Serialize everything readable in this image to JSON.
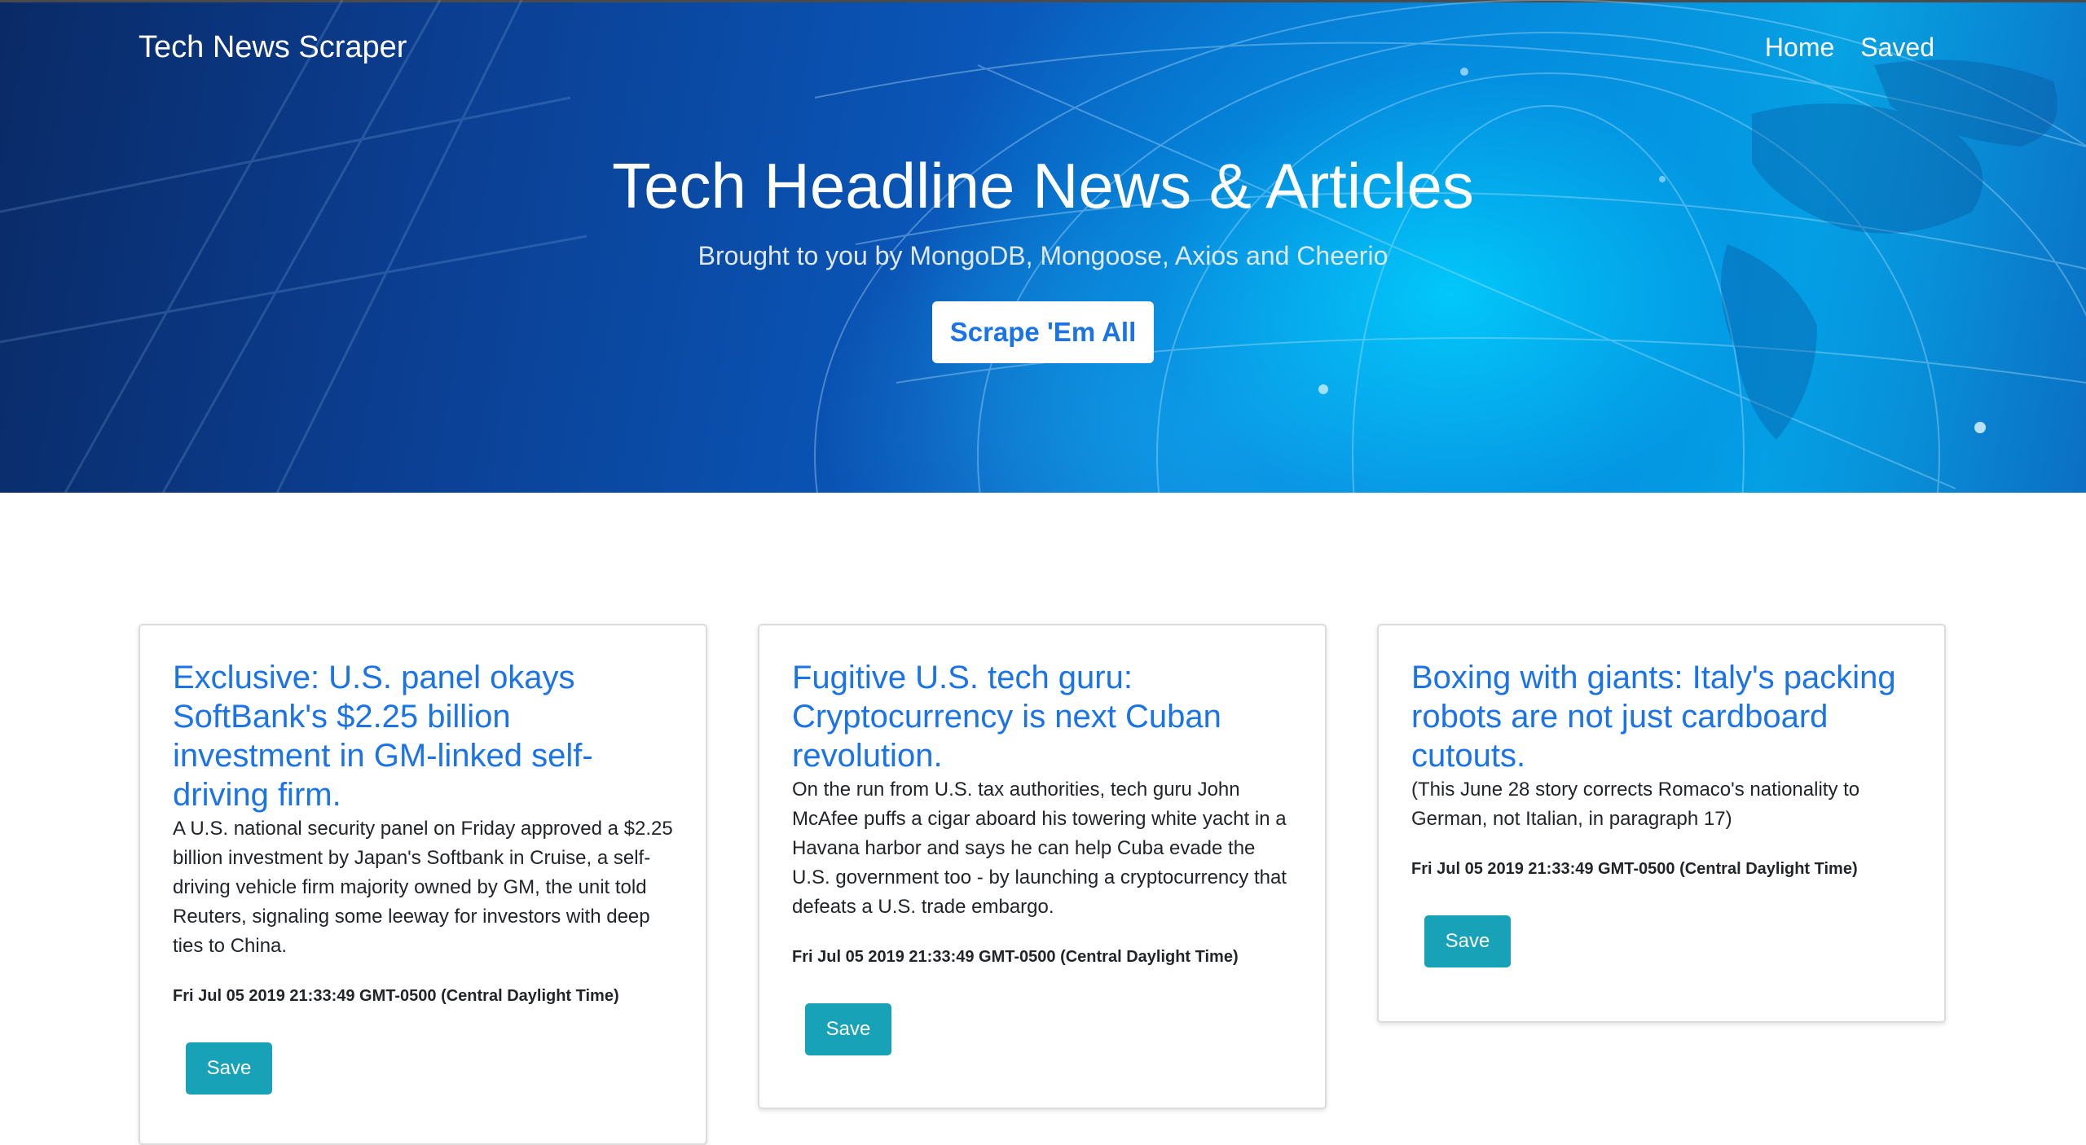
{
  "navbar": {
    "brand": "Tech News Scraper",
    "links": [
      "Home",
      "Saved"
    ]
  },
  "hero": {
    "title": "Tech Headline News & Articles",
    "subtitle": "Brought to you by MongoDB, Mongoose, Axios and Cheerio",
    "button_label": "Scrape 'Em All"
  },
  "articles": [
    {
      "title": "Exclusive: U.S. panel okays SoftBank's $2.25 billion investment in GM-linked self-driving firm.",
      "summary": "A U.S. national security panel on Friday approved a $2.25 billion investment by Japan's Softbank in Cruise, a self-driving vehicle firm majority owned by GM, the unit told Reuters, signaling some leeway for investors with deep ties to China.",
      "date": "Fri Jul 05 2019 21:33:49 GMT-0500 (Central Daylight Time)",
      "save_label": "Save"
    },
    {
      "title": "Fugitive U.S. tech guru: Cryptocurrency is next Cuban revolution.",
      "summary": "On the run from U.S. tax authorities, tech guru John McAfee puffs a cigar aboard his towering white yacht in a Havana harbor and says he can help Cuba evade the U.S. government too - by launching a cryptocurrency that defeats a U.S. trade embargo.",
      "date": "Fri Jul 05 2019 21:33:49 GMT-0500 (Central Daylight Time)",
      "save_label": "Save"
    },
    {
      "title": "Boxing with giants: Italy's packing robots are not just cardboard cutouts.",
      "summary": "(This June 28 story corrects Romaco's nationality to German, not Italian, in paragraph 17)",
      "date": "Fri Jul 05 2019 21:33:49 GMT-0500 (Central Daylight Time)",
      "save_label": "Save"
    }
  ],
  "colors": {
    "link_blue": "#1a73e8",
    "save_button": "#17a2b8",
    "hero_dark": "#0b3d8f",
    "hero_light": "#07a4e3"
  }
}
